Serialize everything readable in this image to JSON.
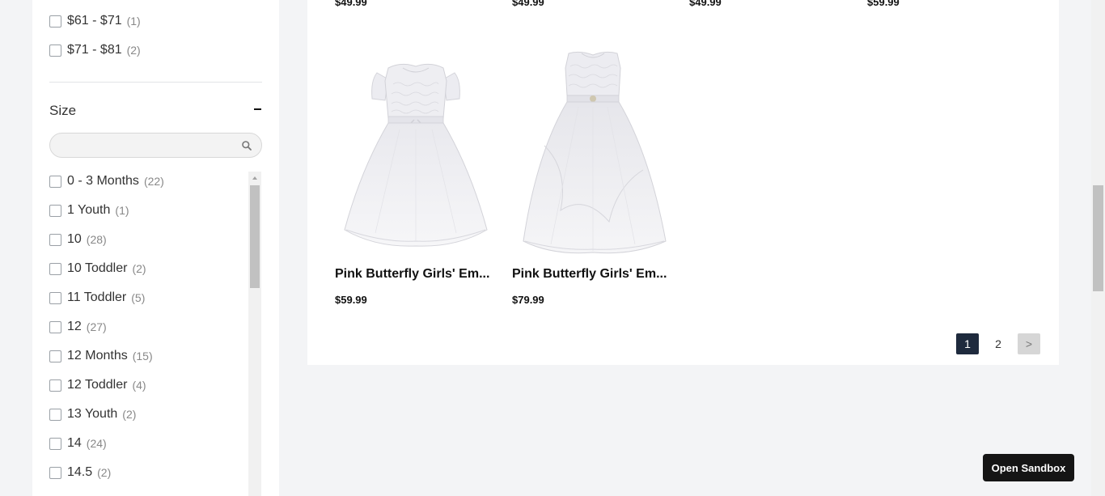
{
  "filters": {
    "price_options": [
      {
        "label": "$61 - $71",
        "count": "(1)"
      },
      {
        "label": "$71 - $81",
        "count": "(2)"
      }
    ],
    "size": {
      "title": "Size",
      "collapse_symbol": "-",
      "search_placeholder": "",
      "options": [
        {
          "label": "0 - 3 Months",
          "count": "(22)"
        },
        {
          "label": "1 Youth",
          "count": "(1)"
        },
        {
          "label": "10",
          "count": "(28)"
        },
        {
          "label": "10 Toddler",
          "count": "(2)"
        },
        {
          "label": "11 Toddler",
          "count": "(5)"
        },
        {
          "label": "12",
          "count": "(27)"
        },
        {
          "label": "12 Months",
          "count": "(15)"
        },
        {
          "label": "12 Toddler",
          "count": "(4)"
        },
        {
          "label": "13 Youth",
          "count": "(2)"
        },
        {
          "label": "14",
          "count": "(24)"
        },
        {
          "label": "14.5",
          "count": "(2)"
        }
      ]
    }
  },
  "products": {
    "previous_row_prices": [
      "$49.99",
      "$49.99",
      "$49.99",
      "$59.99"
    ],
    "items": [
      {
        "title": "Pink Butterfly Girls' Em...",
        "price": "$59.99",
        "image": "white-tulle-girls-dress-short-sleeve"
      },
      {
        "title": "Pink Butterfly Girls' Em...",
        "price": "$79.99",
        "image": "white-tulle-girls-dress-sleeveless"
      }
    ]
  },
  "pagination": {
    "pages": [
      "1",
      "2"
    ],
    "current": "1",
    "next_label": ">"
  },
  "sandbox_button": "Open Sandbox"
}
